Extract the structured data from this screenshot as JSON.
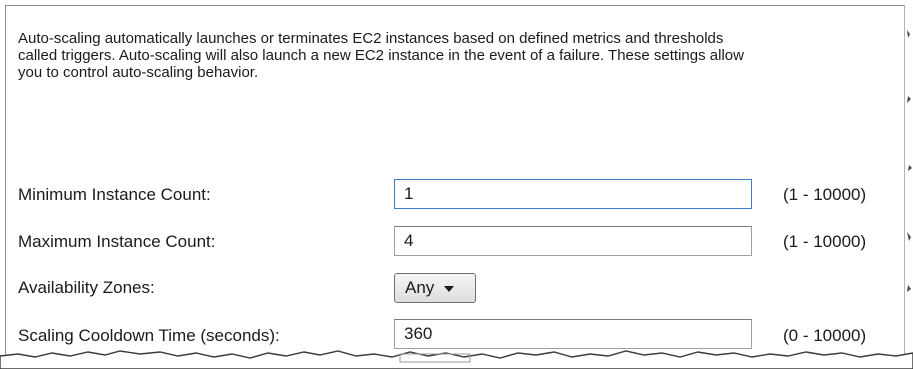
{
  "description": "Auto-scaling automatically launches or terminates EC2 instances based on defined metrics and thresholds called triggers. Auto-scaling will also launch a new EC2 instance in the event of a failure. These settings allow you to control auto-scaling behavior.",
  "rows": [
    {
      "label": "Minimum Instance Count:",
      "value": "1",
      "range": "(1 - 10000)"
    },
    {
      "label": "Maximum Instance Count:",
      "value": "4",
      "range": "(1 - 10000)"
    },
    {
      "label": "Availability Zones:",
      "selected": "Any"
    },
    {
      "label": "Scaling Cooldown Time (seconds):",
      "value": "360",
      "range": "(0 - 10000)"
    }
  ],
  "colors": {
    "focus_border": "#3d7bc6",
    "text": "#1b1b1b"
  },
  "icons": {
    "dropdown": "chevron-down-icon"
  }
}
